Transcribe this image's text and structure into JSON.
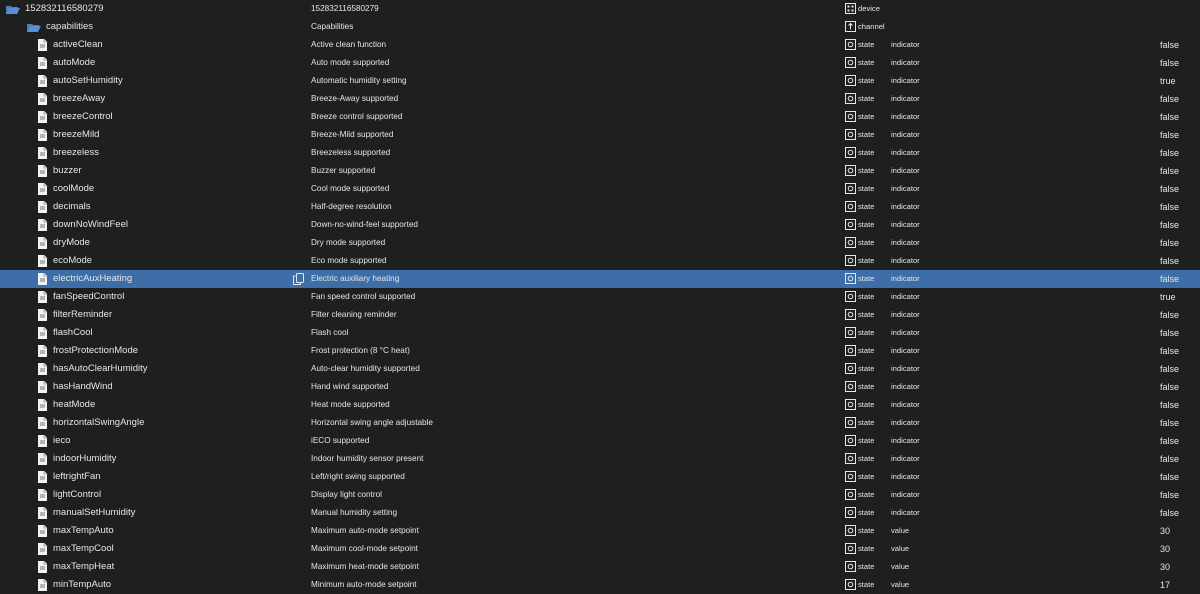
{
  "rows": [
    {
      "id": "152832116580279",
      "name": "152832116580279",
      "type": "device",
      "role": "",
      "value": "",
      "kind": "device",
      "icon": "folder-open-icon"
    },
    {
      "id": "capabilities",
      "name": "Capabilities",
      "type": "channel",
      "role": "",
      "value": "",
      "kind": "channel",
      "icon": "folder-open-icon"
    },
    {
      "id": "activeClean",
      "name": "Active clean function",
      "type": "state",
      "role": "indicator",
      "value": "false",
      "kind": "state",
      "icon": "file-icon"
    },
    {
      "id": "autoMode",
      "name": "Auto mode supported",
      "type": "state",
      "role": "indicator",
      "value": "false",
      "kind": "state",
      "icon": "file-icon"
    },
    {
      "id": "autoSetHumidity",
      "name": "Automatic humidity setting",
      "type": "state",
      "role": "indicator",
      "value": "true",
      "kind": "state",
      "icon": "file-icon"
    },
    {
      "id": "breezeAway",
      "name": "Breeze-Away supported",
      "type": "state",
      "role": "indicator",
      "value": "false",
      "kind": "state",
      "icon": "file-icon"
    },
    {
      "id": "breezeControl",
      "name": "Breeze control supported",
      "type": "state",
      "role": "indicator",
      "value": "false",
      "kind": "state",
      "icon": "file-icon"
    },
    {
      "id": "breezeMild",
      "name": "Breeze-Mild supported",
      "type": "state",
      "role": "indicator",
      "value": "false",
      "kind": "state",
      "icon": "file-icon"
    },
    {
      "id": "breezeless",
      "name": "Breezeless supported",
      "type": "state",
      "role": "indicator",
      "value": "false",
      "kind": "state",
      "icon": "file-icon"
    },
    {
      "id": "buzzer",
      "name": "Buzzer supported",
      "type": "state",
      "role": "indicator",
      "value": "false",
      "kind": "state",
      "icon": "file-icon"
    },
    {
      "id": "coolMode",
      "name": "Cool mode supported",
      "type": "state",
      "role": "indicator",
      "value": "false",
      "kind": "state",
      "icon": "file-icon"
    },
    {
      "id": "decimals",
      "name": "Half-degree resolution",
      "type": "state",
      "role": "indicator",
      "value": "false",
      "kind": "state",
      "icon": "file-icon"
    },
    {
      "id": "downNoWindFeel",
      "name": "Down-no-wind-feel supported",
      "type": "state",
      "role": "indicator",
      "value": "false",
      "kind": "state",
      "icon": "file-icon"
    },
    {
      "id": "dryMode",
      "name": "Dry mode supported",
      "type": "state",
      "role": "indicator",
      "value": "false",
      "kind": "state",
      "icon": "file-icon"
    },
    {
      "id": "ecoMode",
      "name": "Eco mode supported",
      "type": "state",
      "role": "indicator",
      "value": "false",
      "kind": "state",
      "icon": "file-icon"
    },
    {
      "id": "electricAuxHeating",
      "name": "Electric auxiliary heating",
      "type": "state",
      "role": "indicator",
      "value": "false",
      "kind": "state",
      "icon": "file-icon",
      "selected": true
    },
    {
      "id": "fanSpeedControl",
      "name": "Fan speed control supported",
      "type": "state",
      "role": "indicator",
      "value": "true",
      "kind": "state",
      "icon": "file-icon"
    },
    {
      "id": "filterReminder",
      "name": "Filter cleaning reminder",
      "type": "state",
      "role": "indicator",
      "value": "false",
      "kind": "state",
      "icon": "file-icon"
    },
    {
      "id": "flashCool",
      "name": "Flash cool",
      "type": "state",
      "role": "indicator",
      "value": "false",
      "kind": "state",
      "icon": "file-icon"
    },
    {
      "id": "frostProtectionMode",
      "name": "Frost protection (8 °C heat)",
      "type": "state",
      "role": "indicator",
      "value": "false",
      "kind": "state",
      "icon": "file-icon"
    },
    {
      "id": "hasAutoClearHumidity",
      "name": "Auto-clear humidity supported",
      "type": "state",
      "role": "indicator",
      "value": "false",
      "kind": "state",
      "icon": "file-icon"
    },
    {
      "id": "hasHandWind",
      "name": "Hand wind supported",
      "type": "state",
      "role": "indicator",
      "value": "false",
      "kind": "state",
      "icon": "file-icon"
    },
    {
      "id": "heatMode",
      "name": "Heat mode supported",
      "type": "state",
      "role": "indicator",
      "value": "false",
      "kind": "state",
      "icon": "file-icon"
    },
    {
      "id": "horizontalSwingAngle",
      "name": "Horizontal swing angle adjustable",
      "type": "state",
      "role": "indicator",
      "value": "false",
      "kind": "state",
      "icon": "file-icon"
    },
    {
      "id": "ieco",
      "name": "iECO supported",
      "type": "state",
      "role": "indicator",
      "value": "false",
      "kind": "state",
      "icon": "file-icon"
    },
    {
      "id": "indoorHumidity",
      "name": "Indoor humidity sensor present",
      "type": "state",
      "role": "indicator",
      "value": "false",
      "kind": "state",
      "icon": "file-icon"
    },
    {
      "id": "leftrightFan",
      "name": "Left/right swing supported",
      "type": "state",
      "role": "indicator",
      "value": "false",
      "kind": "state",
      "icon": "file-icon"
    },
    {
      "id": "lightControl",
      "name": "Display light control",
      "type": "state",
      "role": "indicator",
      "value": "false",
      "kind": "state",
      "icon": "file-icon"
    },
    {
      "id": "manualSetHumidity",
      "name": "Manual humidity setting",
      "type": "state",
      "role": "indicator",
      "value": "false",
      "kind": "state",
      "icon": "file-icon"
    },
    {
      "id": "maxTempAuto",
      "name": "Maximum auto-mode setpoint",
      "type": "state",
      "role": "value",
      "value": "30",
      "kind": "state",
      "icon": "file-icon"
    },
    {
      "id": "maxTempCool",
      "name": "Maximum cool-mode setpoint",
      "type": "state",
      "role": "value",
      "value": "30",
      "kind": "state",
      "icon": "file-icon"
    },
    {
      "id": "maxTempHeat",
      "name": "Maximum heat-mode setpoint",
      "type": "state",
      "role": "value",
      "value": "30",
      "kind": "state",
      "icon": "file-icon"
    },
    {
      "id": "minTempAuto",
      "name": "Minimum auto-mode setpoint",
      "type": "state",
      "role": "value",
      "value": "17",
      "kind": "state",
      "icon": "file-icon"
    }
  ],
  "colors": {
    "background": "#1f1f1f",
    "text": "#e6e6e6",
    "selected_row": "#3d6ea8",
    "folder": "#5a8fd1"
  },
  "copy_icon": "copy-icon"
}
